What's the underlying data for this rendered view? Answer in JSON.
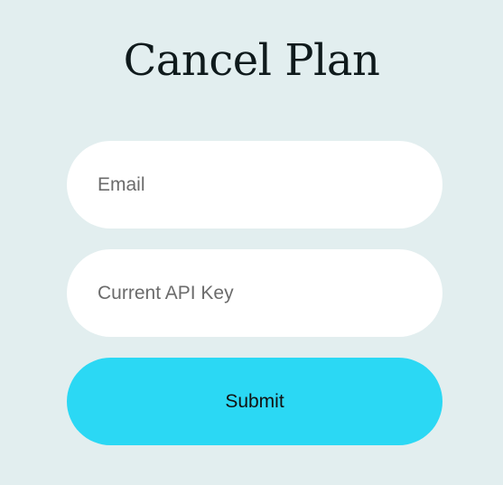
{
  "page": {
    "title": "Cancel Plan"
  },
  "form": {
    "email": {
      "value": "",
      "placeholder": "Email"
    },
    "api_key": {
      "value": "",
      "placeholder": "Current API Key"
    },
    "submit_label": "Submit"
  },
  "colors": {
    "background": "#e2eeef",
    "field_background": "#ffffff",
    "accent": "#2bd8f4",
    "title_text": "#0f1a1c"
  }
}
